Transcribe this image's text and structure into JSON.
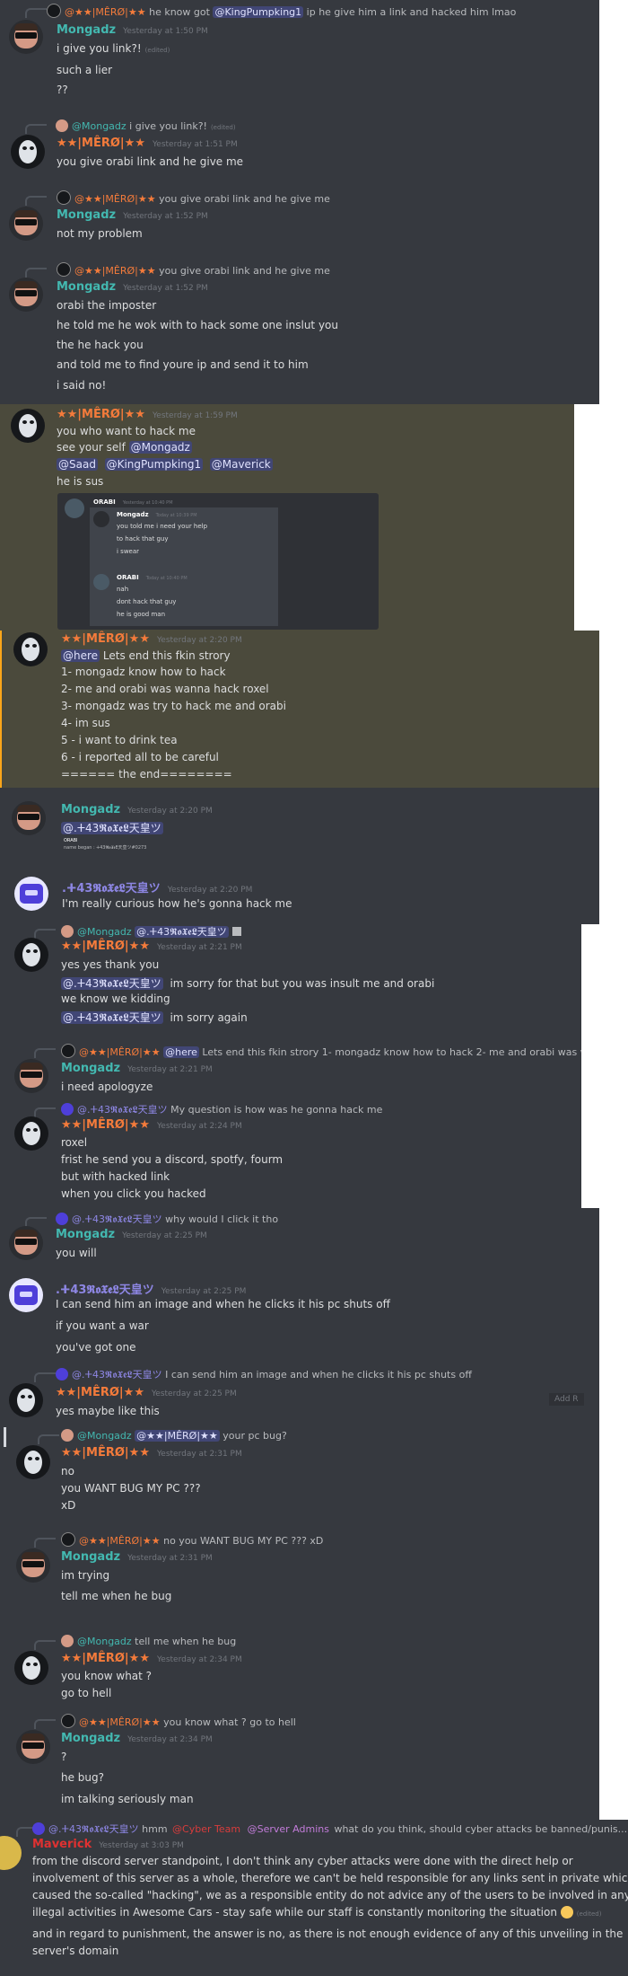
{
  "users": {
    "mongadz": "Mongadz",
    "mero": "★★|MÊRØ|★★",
    "roxel": ".ⵜ43𝕽𝖔𝖃𝖊𝕷天皇ツ",
    "orabi": "ORABI",
    "maverick": "Maverick"
  },
  "colors": {
    "background": "#36393f",
    "highlight": "#4b4a3c",
    "teal": "#43b8b0",
    "orange": "#f47b3b",
    "mention_bg": "#414675",
    "text": "#dcddde"
  },
  "common": {
    "edited": "(edited)"
  },
  "mentions": {
    "kingpumpking": "@KingPumpking1",
    "mongadz": "@Mongadz",
    "saad": "@Saad",
    "maverick": "@Maverick",
    "here": "@here",
    "roxel": "@.ⵜ43𝕽𝖔𝖃𝖊𝕷天皇ツ",
    "mero": "@★★|MÊRØ|★★",
    "red_role": "@Cyber Team",
    "server_admins": "@Server Admins"
  },
  "b1": {
    "reply_prefix": "@★★|MÊRØ|★★",
    "reply_pre": "he know got",
    "reply_post": "ip  he give him a link and hacked him lmao",
    "ts": "Yesterday at 1:50 PM",
    "l1": "i give you link?!",
    "l2": "such  a lier",
    "l3": "??"
  },
  "b2": {
    "reply": "i give you link?!",
    "ts": "Yesterday at 1:51 PM",
    "l1": "you give orabi link and he give me"
  },
  "b3": {
    "reply_prefix": "@★★|MÊRØ|★★",
    "reply": "you give orabi link and he give me",
    "ts": "Yesterday at 1:52 PM",
    "l1": "not my problem"
  },
  "b4": {
    "reply_prefix": "@★★|MÊRØ|★★",
    "reply": "you give orabi link and he give me",
    "ts": "Yesterday at 1:52 PM",
    "l1": "orabi the imposter",
    "l2": "he told me he wok with to hack some one inslut you",
    "l3": "the he hack you",
    "l4": "and told me to find youre ip and send it to him",
    "l5": "i said no!"
  },
  "b5": {
    "ts": "Yesterday at 1:59 PM",
    "l1": "you who want to hack me",
    "l2": "see your self",
    "l4": "he is sus",
    "embed": {
      "orabi_ts1": "Yesterday at 10:40 PM",
      "m_ts": "Today at 10:39 PM",
      "m1": "you told me i need your help",
      "m2": "to hack that guy",
      "m3": "i swear",
      "orabi_ts2": "Today at 10:40 PM",
      "o1": "nah",
      "o2": "dont hack that guy",
      "o3": "he is good man"
    }
  },
  "b6": {
    "ts": "Yesterday at 2:20 PM",
    "l1": "Lets end this fkin strory",
    "l2": "1- mongadz know how to hack",
    "l3": "2- me and orabi was wanna hack roxel",
    "l4": "3- mongadz was try to hack me and orabi",
    "l5": "4- im sus",
    "l6": "5 - i want to drink tea",
    "l7": "6 - i reported all to be careful",
    "l8": "====== the end========"
  },
  "b7": {
    "ts": "Yesterday at 2:20 PM",
    "l1": "@.ⵜ43𝕽𝖔𝖃𝖊𝕷天皇ツ",
    "sub": "name began : ⵜ43𝕽𝖔𝖃𝖊𝕷天皇ツ#0273"
  },
  "b8": {
    "ts": "Yesterday at 2:20 PM",
    "l1": "I'm really curious how he's gonna hack me"
  },
  "b9": {
    "ts": "Yesterday at 2:21 PM",
    "l1": "yes yes thank you",
    "l2_post": "im sorry for that but you was insult me and orabi",
    "l3": "we know we kidding",
    "l4_post": "im sorry again"
  },
  "b10": {
    "reply_prefix": "@★★|MÊRØ|★★",
    "reply_post": "Lets end this fkin strory  1- mongadz know how to hack  2- me and orabi was wan",
    "ts": "Yesterday at 2:21 PM",
    "l1": "i need apologyze"
  },
  "b11": {
    "reply_prefix": "@.ⵜ43𝕽𝖔𝖃𝖊𝕷天皇ツ",
    "reply": "My question is how was he gonna hack me",
    "ts": "Yesterday at 2:24 PM",
    "l1": "roxel",
    "l2": "frist he send you a discord, spotfy, fourm",
    "l3": "but with hacked link",
    "l4": "when you click you hacked"
  },
  "b12": {
    "reply_prefix": "@.ⵜ43𝕽𝖔𝖃𝖊𝕷天皇ツ",
    "reply": "why would I click it tho",
    "ts": "Yesterday at 2:25 PM",
    "l1": "you will"
  },
  "b13": {
    "ts": "Yesterday at 2:25 PM",
    "l1": "I can send him an image and when he clicks it his pc shuts off",
    "l2": "if you want a war",
    "l3": "you've got one"
  },
  "b14": {
    "reply_prefix": "@.ⵜ43𝕽𝖔𝖃𝖊𝕷天皇ツ",
    "reply": "I can send him an image and when he clicks it his pc shuts off",
    "ts": "Yesterday at 2:25 PM",
    "l1": "yes maybe like this",
    "add": "Add R"
  },
  "b15": {
    "reply_post": "your pc bug?",
    "ts": "Yesterday at 2:31 PM",
    "l1": "no",
    "l2": "you WANT BUG MY PC ???",
    "l3": "xD"
  },
  "b16": {
    "reply_prefix": "@★★|MÊRØ|★★",
    "reply": "no  you WANT BUG MY PC ???  xD",
    "ts": "Yesterday at 2:31 PM",
    "l1": "im trying",
    "l2": "tell me when he bug"
  },
  "b17": {
    "reply": "tell me when he bug",
    "ts": "Yesterday at 2:34 PM",
    "l1": "you know what ?",
    "l2": "go to hell"
  },
  "b18": {
    "reply_prefix": "@★★|MÊRØ|★★",
    "reply": "you know what ?  go to hell",
    "ts": "Yesterday at 2:34 PM",
    "l1": "?",
    "l2": "he bug?",
    "l3": "im talking seriously man"
  },
  "b19": {
    "reply_prefix": "@.ⵜ43𝕽𝖔𝖃𝖊𝕷天皇ツ",
    "reply_pre": "hmm",
    "reply_post": "what do you think, should cyber attacks be banned/punis...",
    "ts": "Yesterday at 3:03 PM",
    "l1": "from the discord server standpoint, I don't think any cyber attacks were done with the direct help or",
    "l2": "involvement of this server as a whole, therefore we can't be held responsible for any links sent in private which",
    "l3": "caused the so-called \"hacking\", we as a responsible entity do not advice any of the users to be involved in any",
    "l4": "illegal activities in Awesome Cars - stay safe while our staff is constantly monitoring the situation",
    "l5": "and in regard to punishment, the answer is no, as there is not enough evidence of any of this unveiling in the",
    "l6": "server's domain"
  }
}
